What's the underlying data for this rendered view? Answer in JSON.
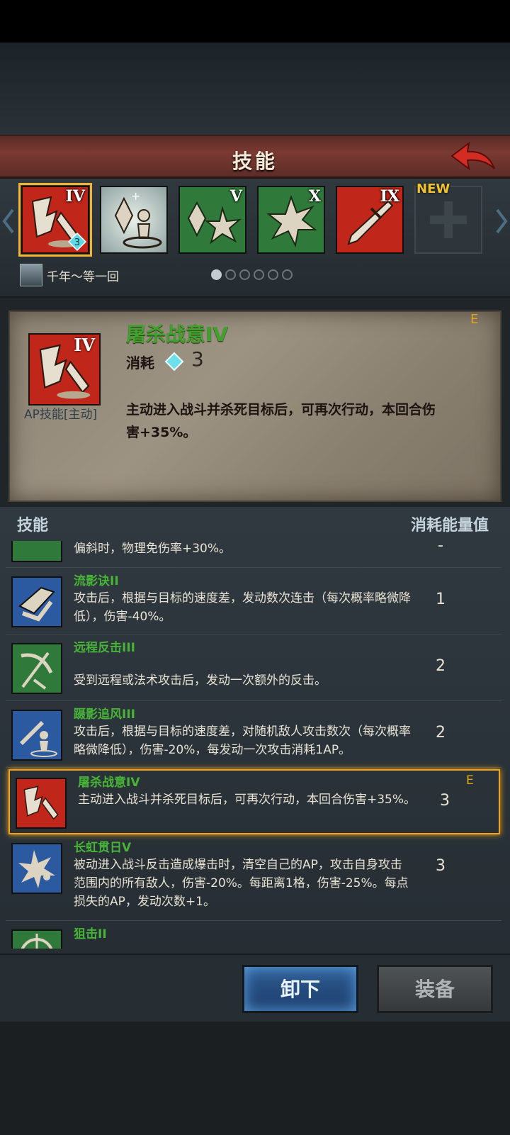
{
  "header": {
    "title": "技能"
  },
  "skillbar": {
    "slots": [
      {
        "roman": "IV",
        "icon": "slaughter-icon",
        "color": "#c0261a",
        "level": "3"
      },
      {
        "roman": "",
        "icon": "crystal-summon-icon",
        "color": "#b8c8c8"
      },
      {
        "roman": "V",
        "icon": "crystal-burst-icon",
        "color": "#2f7a3a"
      },
      {
        "roman": "X",
        "icon": "burst-icon",
        "color": "#2f7a3a"
      },
      {
        "roman": "IX",
        "icon": "sword-icon",
        "color": "#c0261a"
      },
      {
        "roman": "",
        "icon": "empty-slot-icon",
        "color": "#2e363b"
      }
    ],
    "new_label": "NEW",
    "owner_name": "千年～等一回",
    "page_count": 6,
    "active_page": 0
  },
  "detail": {
    "name": "屠杀战意IV",
    "roman": "IV",
    "cost_label": "消耗",
    "cost": "3",
    "type": "AP技能[主动]",
    "grade": "E",
    "desc": "主动进入战斗并杀死目标后，可再次行动，本回合伤害+35%。"
  },
  "list": {
    "header_left": "技能",
    "header_right": "消耗能量值",
    "rows": [
      {
        "name": "",
        "desc": "偏斜时，物理免伤率+30%。",
        "cost": "-",
        "icon": "shield-icon",
        "color": "#2f7a3a"
      },
      {
        "name": "流影诀II",
        "desc": "攻击后，根据与目标的速度差，发动数次连击（每次概率略微降低），伤害-40%。",
        "cost": "1",
        "icon": "blade-flurry-icon",
        "color": "#2b5aa0"
      },
      {
        "name": "远程反击III",
        "desc": "受到远程或法术攻击后，发动一次额外的反击。",
        "cost": "2",
        "icon": "bow-counter-icon",
        "color": "#2f7a3a"
      },
      {
        "name": "蹑影追风III",
        "desc": "攻击后，根据与目标的速度差，对随机敌人攻击数次（每次概率略微降低），伤害-20%，每发动一次攻击消耗1AP。",
        "cost": "2",
        "icon": "shadow-sword-icon",
        "color": "#2b5aa0"
      },
      {
        "name": "屠杀战意IV",
        "desc": "主动进入战斗并杀死目标后，可再次行动，本回合伤害+35%。",
        "cost": "3",
        "icon": "slaughter-icon",
        "color": "#c0261a",
        "grade": "E"
      },
      {
        "name": "长虹贯日V",
        "desc": "被动进入战斗反击造成爆击时，清空自己的AP，攻击自身攻击范围内的所有敌人，伤害-20%。每距离1格，伤害-25%。每点损失的AP，发动次数+1。",
        "cost": "3",
        "icon": "rainbow-burst-icon",
        "color": "#2b5aa0"
      },
      {
        "name": "狙击II",
        "desc": "",
        "cost": "",
        "icon": "target-icon",
        "color": "#2f7a3a"
      }
    ]
  },
  "footer": {
    "unequip_label": "卸下",
    "equip_label": "装备"
  }
}
